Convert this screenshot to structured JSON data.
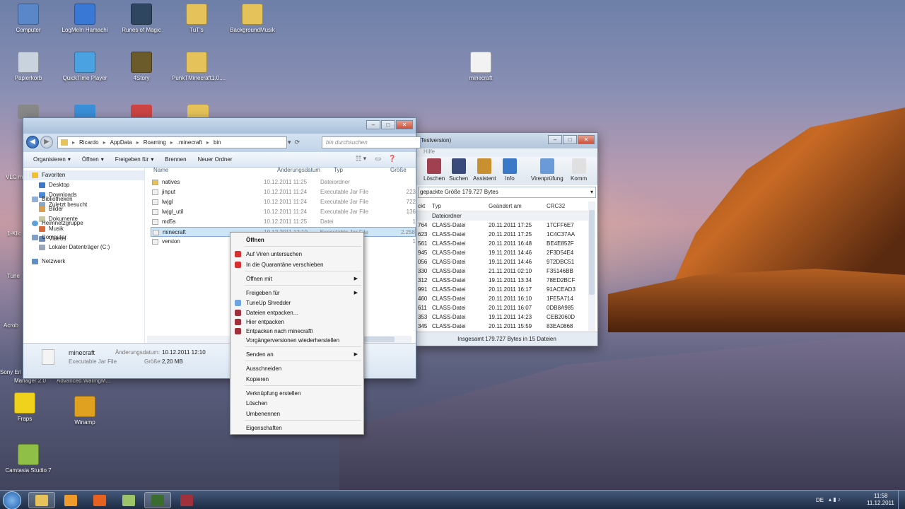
{
  "desktop": {
    "icons": [
      {
        "label": "Computer",
        "color": "#5a87c7"
      },
      {
        "label": "LogMeIn Hamachi",
        "color": "#3a78d6"
      },
      {
        "label": "Runes of Magic",
        "color": "#2f4660"
      },
      {
        "label": "TuT's",
        "color": "#e6c35a"
      },
      {
        "label": "BackgroundMusik",
        "color": "#e6c35a"
      },
      {
        "label": "Papierkorb",
        "color": "#c9d3dd"
      },
      {
        "label": "QuickTime Player",
        "color": "#4aa3e0"
      },
      {
        "label": "4Story",
        "color": "#6b5a2a"
      },
      {
        "label": "PunkTMinecraft1.0....",
        "color": "#e6c35a"
      },
      {
        "label": "minecraft",
        "color": "#f2f2f2"
      },
      {
        "label": "Fraps",
        "color": "#f0d21c"
      },
      {
        "label": "Winamp",
        "color": "#e0a020"
      },
      {
        "label": "Camtasia Studio 7",
        "color": "#8fbf46"
      }
    ],
    "partial_labels": [
      "Sony Eri",
      "Manager 2.0",
      "Advanced WaringM...",
      "Acrob",
      "1-Klic",
      "Tune",
      "VLC me"
    ]
  },
  "explorer": {
    "breadcrumb": [
      "Ricardo",
      "AppData",
      "Roaming",
      ".minecraft",
      "bin"
    ],
    "search_placeholder": "bin durchsuchen",
    "toolbar": [
      "Organisieren",
      "Öffnen",
      "Freigeben für",
      "Brennen",
      "Neuer Ordner"
    ],
    "nav": {
      "favorites": "Favoriten",
      "favorites_items": [
        "Desktop",
        "Downloads",
        "Zuletzt besucht"
      ],
      "libraries": "Bibliotheken",
      "libraries_items": [
        "Bilder",
        "Dokumente",
        "Musik",
        "Videos"
      ],
      "homegroup": "Heimnetzgruppe",
      "computer": "Computer",
      "computer_items": [
        "Lokaler Datenträger (C:)"
      ],
      "network": "Netzwerk"
    },
    "columns": [
      "Name",
      "Änderungsdatum",
      "Typ",
      "Größe"
    ],
    "files": [
      {
        "name": "natives",
        "date": "10.12.2011 11:25",
        "type": "Dateiordner",
        "size": ""
      },
      {
        "name": "jinput",
        "date": "10.12.2011 11:24",
        "type": "Executable Jar File",
        "size": "223"
      },
      {
        "name": "lwjgl",
        "date": "10.12.2011 11:24",
        "type": "Executable Jar File",
        "size": "722"
      },
      {
        "name": "lwjgl_util",
        "date": "10.12.2011 11:24",
        "type": "Executable Jar File",
        "size": "136"
      },
      {
        "name": "md5s",
        "date": "10.12.2011 11:25",
        "type": "Datei",
        "size": "1"
      },
      {
        "name": "minecraft",
        "date": "10.12.2011 12:10",
        "type": "Executable Jar File",
        "size": "2.258"
      },
      {
        "name": "version",
        "date": "",
        "type": "",
        "size": "1"
      }
    ],
    "details": {
      "name": "minecraft",
      "type": "Executable Jar File",
      "date_label": "Änderungsdatum:",
      "date": "10.12.2011 12:10",
      "size_label": "Größe:",
      "size": "2,20 MB"
    }
  },
  "context_menu": {
    "items": [
      "Öffnen",
      "Auf Viren untersuchen",
      "In die Quarantäne verschieben",
      "Öffnen mit",
      "Freigeben für",
      "TuneUp Shredder",
      "Dateien entpacken...",
      "Hier entpacken",
      "Entpacken nach minecraft\\",
      "Vorgängerversionen wiederherstellen",
      "Senden an",
      "Ausschneiden",
      "Kopieren",
      "Verknüpfung erstellen",
      "Löschen",
      "Umbenennen",
      "Eigenschaften"
    ]
  },
  "archiver": {
    "title": "Testversion)",
    "menu": "Hilfe",
    "tools": [
      "Löschen",
      "Suchen",
      "Assistent",
      "Info",
      "Virenprüfung",
      "Komm"
    ],
    "packed_size": "gepackte Größe 179.727 Bytes",
    "columns": [
      "ckt",
      "Typ",
      "Geändert am",
      "CRC32"
    ],
    "folder_type": "Dateiordner",
    "rows": [
      {
        "p": "764",
        "type": "CLASS-Datei",
        "date": "20.11.2011 17:25",
        "crc": "17CFF6E7"
      },
      {
        "p": "623",
        "type": "CLASS-Datei",
        "date": "20.11.2011 17:25",
        "crc": "1C4C37AA"
      },
      {
        "p": "561",
        "type": "CLASS-Datei",
        "date": "20.11.2011 16:48",
        "crc": "BE4E852F"
      },
      {
        "p": "945",
        "type": "CLASS-Datei",
        "date": "19.11.2011 14:46",
        "crc": "2F3D54E4"
      },
      {
        "p": "056",
        "type": "CLASS-Datei",
        "date": "19.11.2011 14:46",
        "crc": "972DBC51"
      },
      {
        "p": "330",
        "type": "CLASS-Datei",
        "date": "21.11.2011 02:10",
        "crc": "F35146BB"
      },
      {
        "p": "312",
        "type": "CLASS-Datei",
        "date": "19.11.2011 13:34",
        "crc": "78ED2BCF"
      },
      {
        "p": "991",
        "type": "CLASS-Datei",
        "date": "20.11.2011 16:17",
        "crc": "91ACEAD3"
      },
      {
        "p": "460",
        "type": "CLASS-Datei",
        "date": "20.11.2011 16:10",
        "crc": "1FE5A714"
      },
      {
        "p": "611",
        "type": "CLASS-Datei",
        "date": "20.11.2011 16:07",
        "crc": "0DB8A985"
      },
      {
        "p": "353",
        "type": "CLASS-Datei",
        "date": "19.11.2011 14:23",
        "crc": "CEB2060D"
      },
      {
        "p": "345",
        "type": "CLASS-Datei",
        "date": "20.11.2011 15:59",
        "crc": "83EA0868"
      }
    ],
    "status": "Insgesamt 179.727 Bytes in 15 Dateien"
  },
  "taskbar": {
    "lang": "DE",
    "time": "11:58",
    "date": "11.12.2011",
    "apps": [
      {
        "name": "explorer",
        "color": "#e6c35a"
      },
      {
        "name": "media-player",
        "color": "#f09a2a"
      },
      {
        "name": "firefox",
        "color": "#e8621f"
      },
      {
        "name": "notepad-folder",
        "color": "#9ec46a"
      },
      {
        "name": "minecraft",
        "color": "#3c6b2f"
      },
      {
        "name": "archiver",
        "color": "#a0303c"
      }
    ]
  },
  "colors": {
    "selection": "#cde6f7",
    "accent": "#245aa8"
  }
}
